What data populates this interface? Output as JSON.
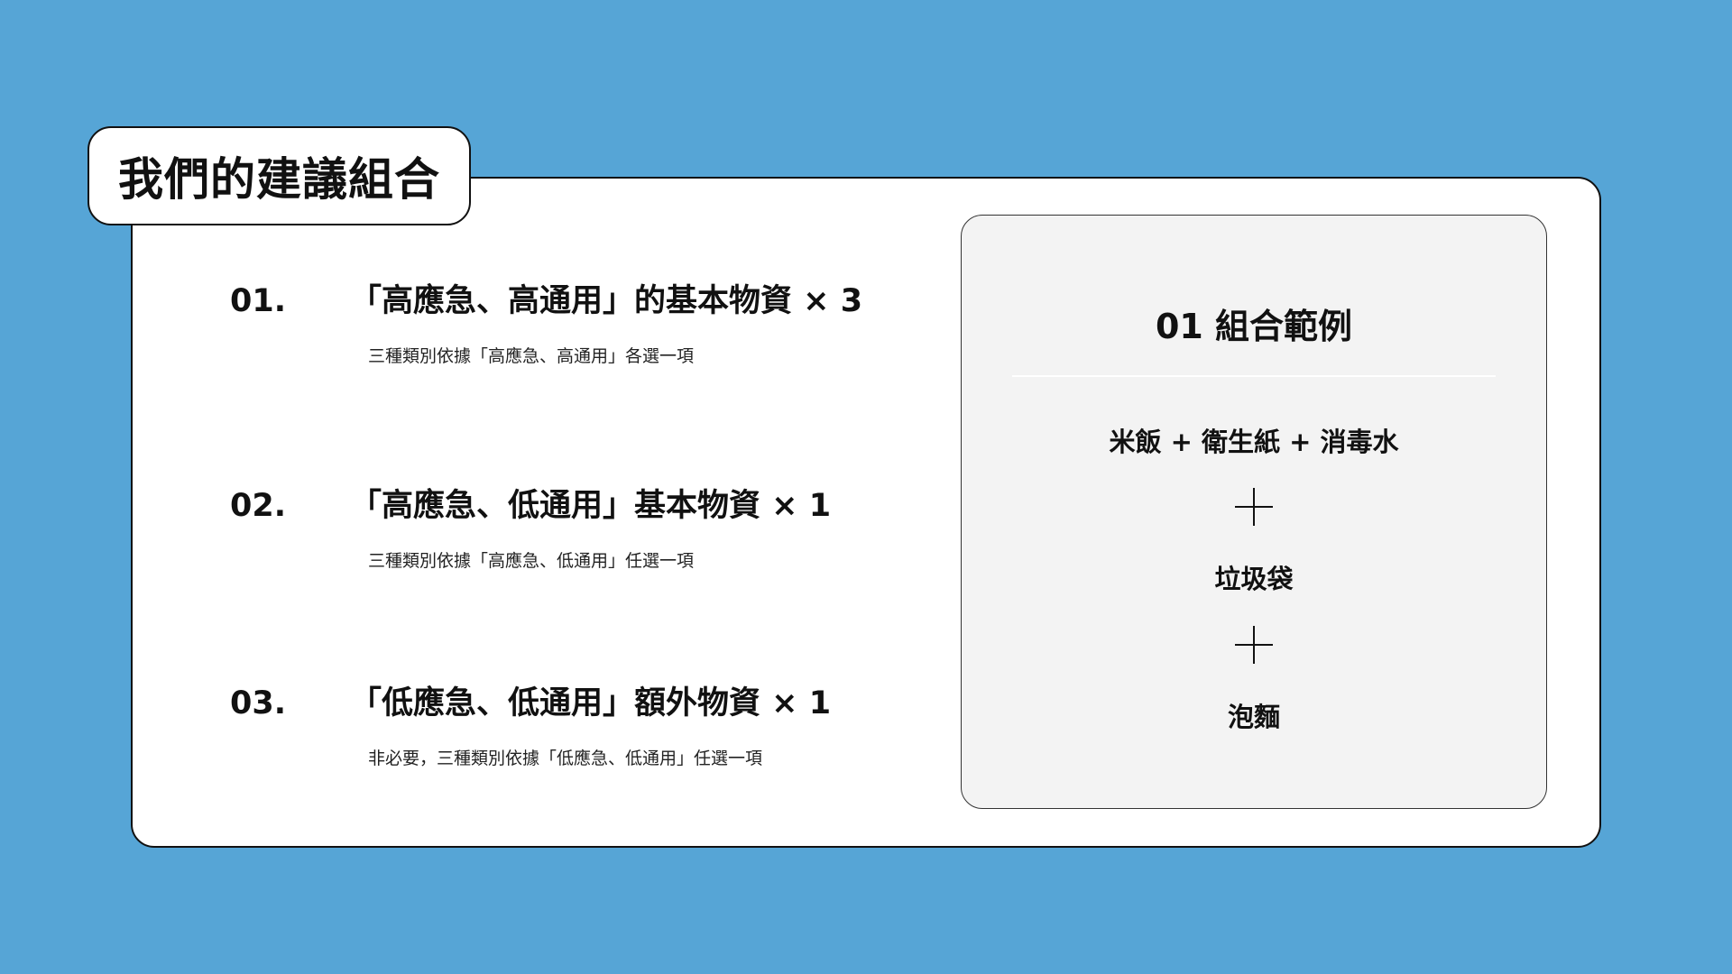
{
  "header": {
    "title": "我們的建議組合"
  },
  "items": [
    {
      "number": "01.",
      "title": "「高應急、高通用」的基本物資 × 3",
      "description": "三種類別依據「高應急、高通用」各選一項"
    },
    {
      "number": "02.",
      "title": "「高應急、低通用」基本物資 × 1",
      "description": "三種類別依據「高應急、低通用」任選一項"
    },
    {
      "number": "03.",
      "title": "「低應急、低通用」額外物資 × 1",
      "description": "非必要，三種類別依據「低應急、低通用」任選一項"
    }
  ],
  "example": {
    "title": "01 組合範例",
    "lines": [
      "米飯 + 衛生紙 + 消毒水",
      "垃圾袋",
      "泡麵"
    ]
  },
  "colors": {
    "background": "#56a5d6",
    "card": "#ffffff",
    "panel": "#f3f3f3"
  }
}
